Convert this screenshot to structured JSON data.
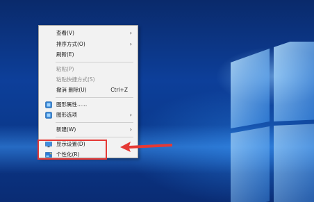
{
  "menu": {
    "items": [
      {
        "label": "查看(V)",
        "submenu": "›"
      },
      {
        "label": "排序方式(O)",
        "submenu": "›"
      },
      {
        "label": "刷新(E)"
      },
      {
        "label": "粘贴(P)"
      },
      {
        "label": "粘贴快捷方式(S)"
      },
      {
        "label": "撤消 删除(U)",
        "shortcut": "Ctrl+Z"
      },
      {
        "label": "图形属性......"
      },
      {
        "label": "图形选项",
        "submenu": "›"
      },
      {
        "label": "新建(W)",
        "submenu": "›"
      },
      {
        "label": "显示设置(D)"
      },
      {
        "label": "个性化(R)"
      }
    ]
  },
  "icons": {
    "graphics_properties": "intel-graphics-icon",
    "graphics_options": "intel-graphics-icon",
    "display_settings": "display-monitor-icon",
    "personalize": "personalize-icon"
  },
  "colors": {
    "annotation": "#e53935",
    "menu_bg": "#f2f2f2",
    "desktop_blue": "#0d3f9a"
  }
}
